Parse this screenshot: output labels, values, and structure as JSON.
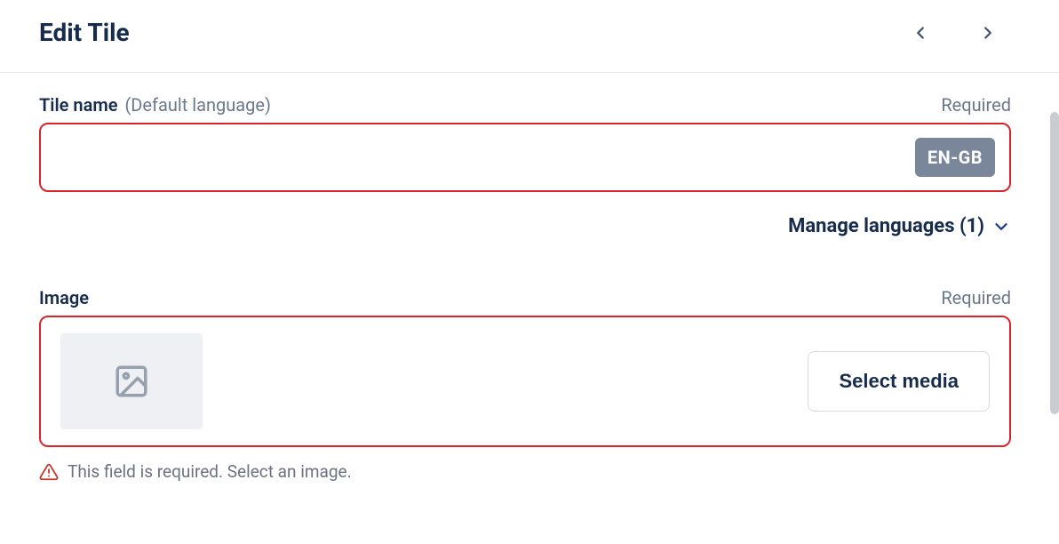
{
  "header": {
    "title": "Edit Tile"
  },
  "tileName": {
    "label": "Tile name",
    "sublabel": "(Default language)",
    "required": "Required",
    "value": "",
    "badge": "EN-GB"
  },
  "manageLanguages": {
    "label": "Manage languages (1)"
  },
  "image": {
    "label": "Image",
    "required": "Required",
    "buttonLabel": "Select media",
    "error": "This field is required. Select an image."
  }
}
